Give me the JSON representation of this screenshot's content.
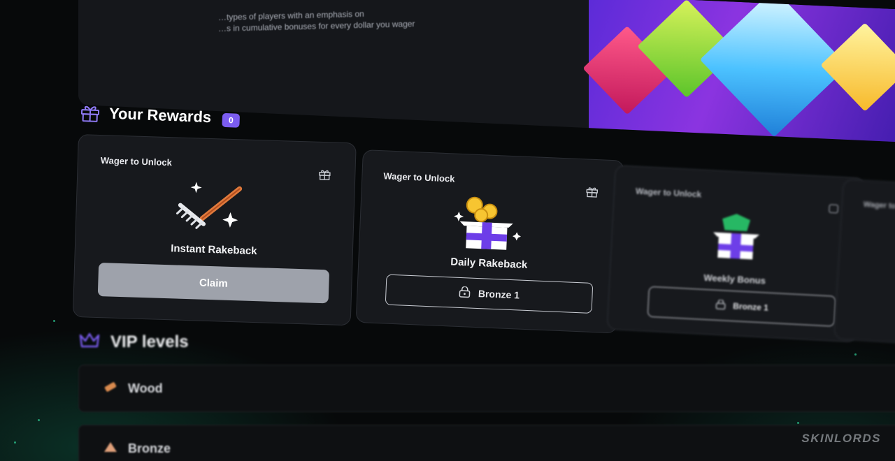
{
  "hero": {
    "text_line_1": "…types of players with an emphasis on",
    "text_line_2": "…s in cumulative bonuses for every dollar you wager"
  },
  "rewards": {
    "title": "Your Rewards",
    "count": "0",
    "cards": [
      {
        "label": "Wager to Unlock",
        "name": "Instant Rakeback",
        "button": "Claim",
        "icon": "rake-icon"
      },
      {
        "label": "Wager to Unlock",
        "name": "Daily Rakeback",
        "button": "Bronze 1",
        "icon": "coins-gift-icon"
      },
      {
        "label": "Wager to Unlock",
        "name": "Weekly Bonus",
        "button": "Bronze 1",
        "icon": "gem-gift-icon"
      },
      {
        "label": "Wager to Unlock",
        "name": "",
        "button": "",
        "icon": ""
      }
    ]
  },
  "vip": {
    "title": "VIP levels",
    "levels": [
      {
        "name": "Wood",
        "icon": "wood-icon"
      },
      {
        "name": "Bronze",
        "icon": "bronze-icon"
      }
    ]
  },
  "watermark": "SKINLORDS",
  "colors": {
    "accent": "#7b5cf0",
    "claim_button": "#9ea2ab",
    "card_bg": "#17191d",
    "background": "#07090a"
  }
}
